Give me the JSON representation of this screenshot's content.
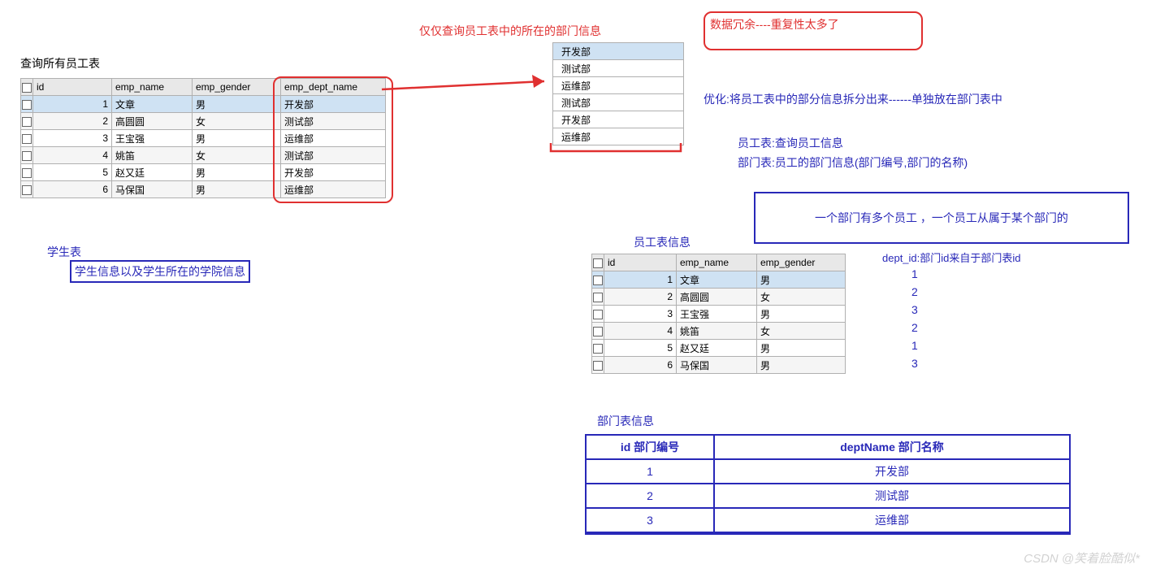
{
  "titles": {
    "queryAll": "查询所有员工表",
    "queryDept": "仅仅查询员工表中的所在的部门信息",
    "redundant": "数据冗余----重复性太多了",
    "optimize": "优化:将员工表中的部分信息拆分出来------单独放在部门表中",
    "empDesc": "员工表:查询员工信息",
    "deptDesc": "部门表:员工的部门信息(部门编号,部门的名称)",
    "relation": "一个部门有多个员工 ，一个员工从属于某个部门的",
    "deptIdNote": "dept_id:部门id来自于部门表id",
    "studentTable": "学生表",
    "studentInfo": "学生信息以及学生所在的学院信息",
    "empInfoTitle": "员工表信息",
    "deptInfoTitle": "部门表信息"
  },
  "empTable": {
    "headers": [
      "id",
      "emp_name",
      "emp_gender",
      "emp_dept_name"
    ],
    "rows": [
      {
        "id": "1",
        "name": "文章",
        "gender": "男",
        "dept": "开发部",
        "sel": true
      },
      {
        "id": "2",
        "name": "高圆圆",
        "gender": "女",
        "dept": "测试部"
      },
      {
        "id": "3",
        "name": "王宝强",
        "gender": "男",
        "dept": "运维部"
      },
      {
        "id": "4",
        "name": "姚笛",
        "gender": "女",
        "dept": "测试部"
      },
      {
        "id": "5",
        "name": "赵又廷",
        "gender": "男",
        "dept": "开发部"
      },
      {
        "id": "6",
        "name": "马保国",
        "gender": "男",
        "dept": "运维部"
      }
    ]
  },
  "deptOnly": [
    "开发部",
    "测试部",
    "运维部",
    "测试部",
    "开发部",
    "运维部"
  ],
  "empTable2": {
    "headers": [
      "id",
      "emp_name",
      "emp_gender"
    ],
    "rows": [
      {
        "id": "1",
        "name": "文章",
        "gender": "男",
        "sel": true
      },
      {
        "id": "2",
        "name": "高圆圆",
        "gender": "女"
      },
      {
        "id": "3",
        "name": "王宝强",
        "gender": "男"
      },
      {
        "id": "4",
        "name": "姚笛",
        "gender": "女"
      },
      {
        "id": "5",
        "name": "赵又廷",
        "gender": "男"
      },
      {
        "id": "6",
        "name": "马保国",
        "gender": "男"
      }
    ]
  },
  "deptIds": [
    "1",
    "2",
    "3",
    "2",
    "1",
    "3"
  ],
  "deptTable": {
    "headers": [
      "id 部门编号",
      "deptName 部门名称"
    ],
    "rows": [
      {
        "id": "1",
        "name": "开发部"
      },
      {
        "id": "2",
        "name": "测试部"
      },
      {
        "id": "3",
        "name": "运维部"
      }
    ]
  },
  "watermark": "CSDN @笑着脸酷似*"
}
